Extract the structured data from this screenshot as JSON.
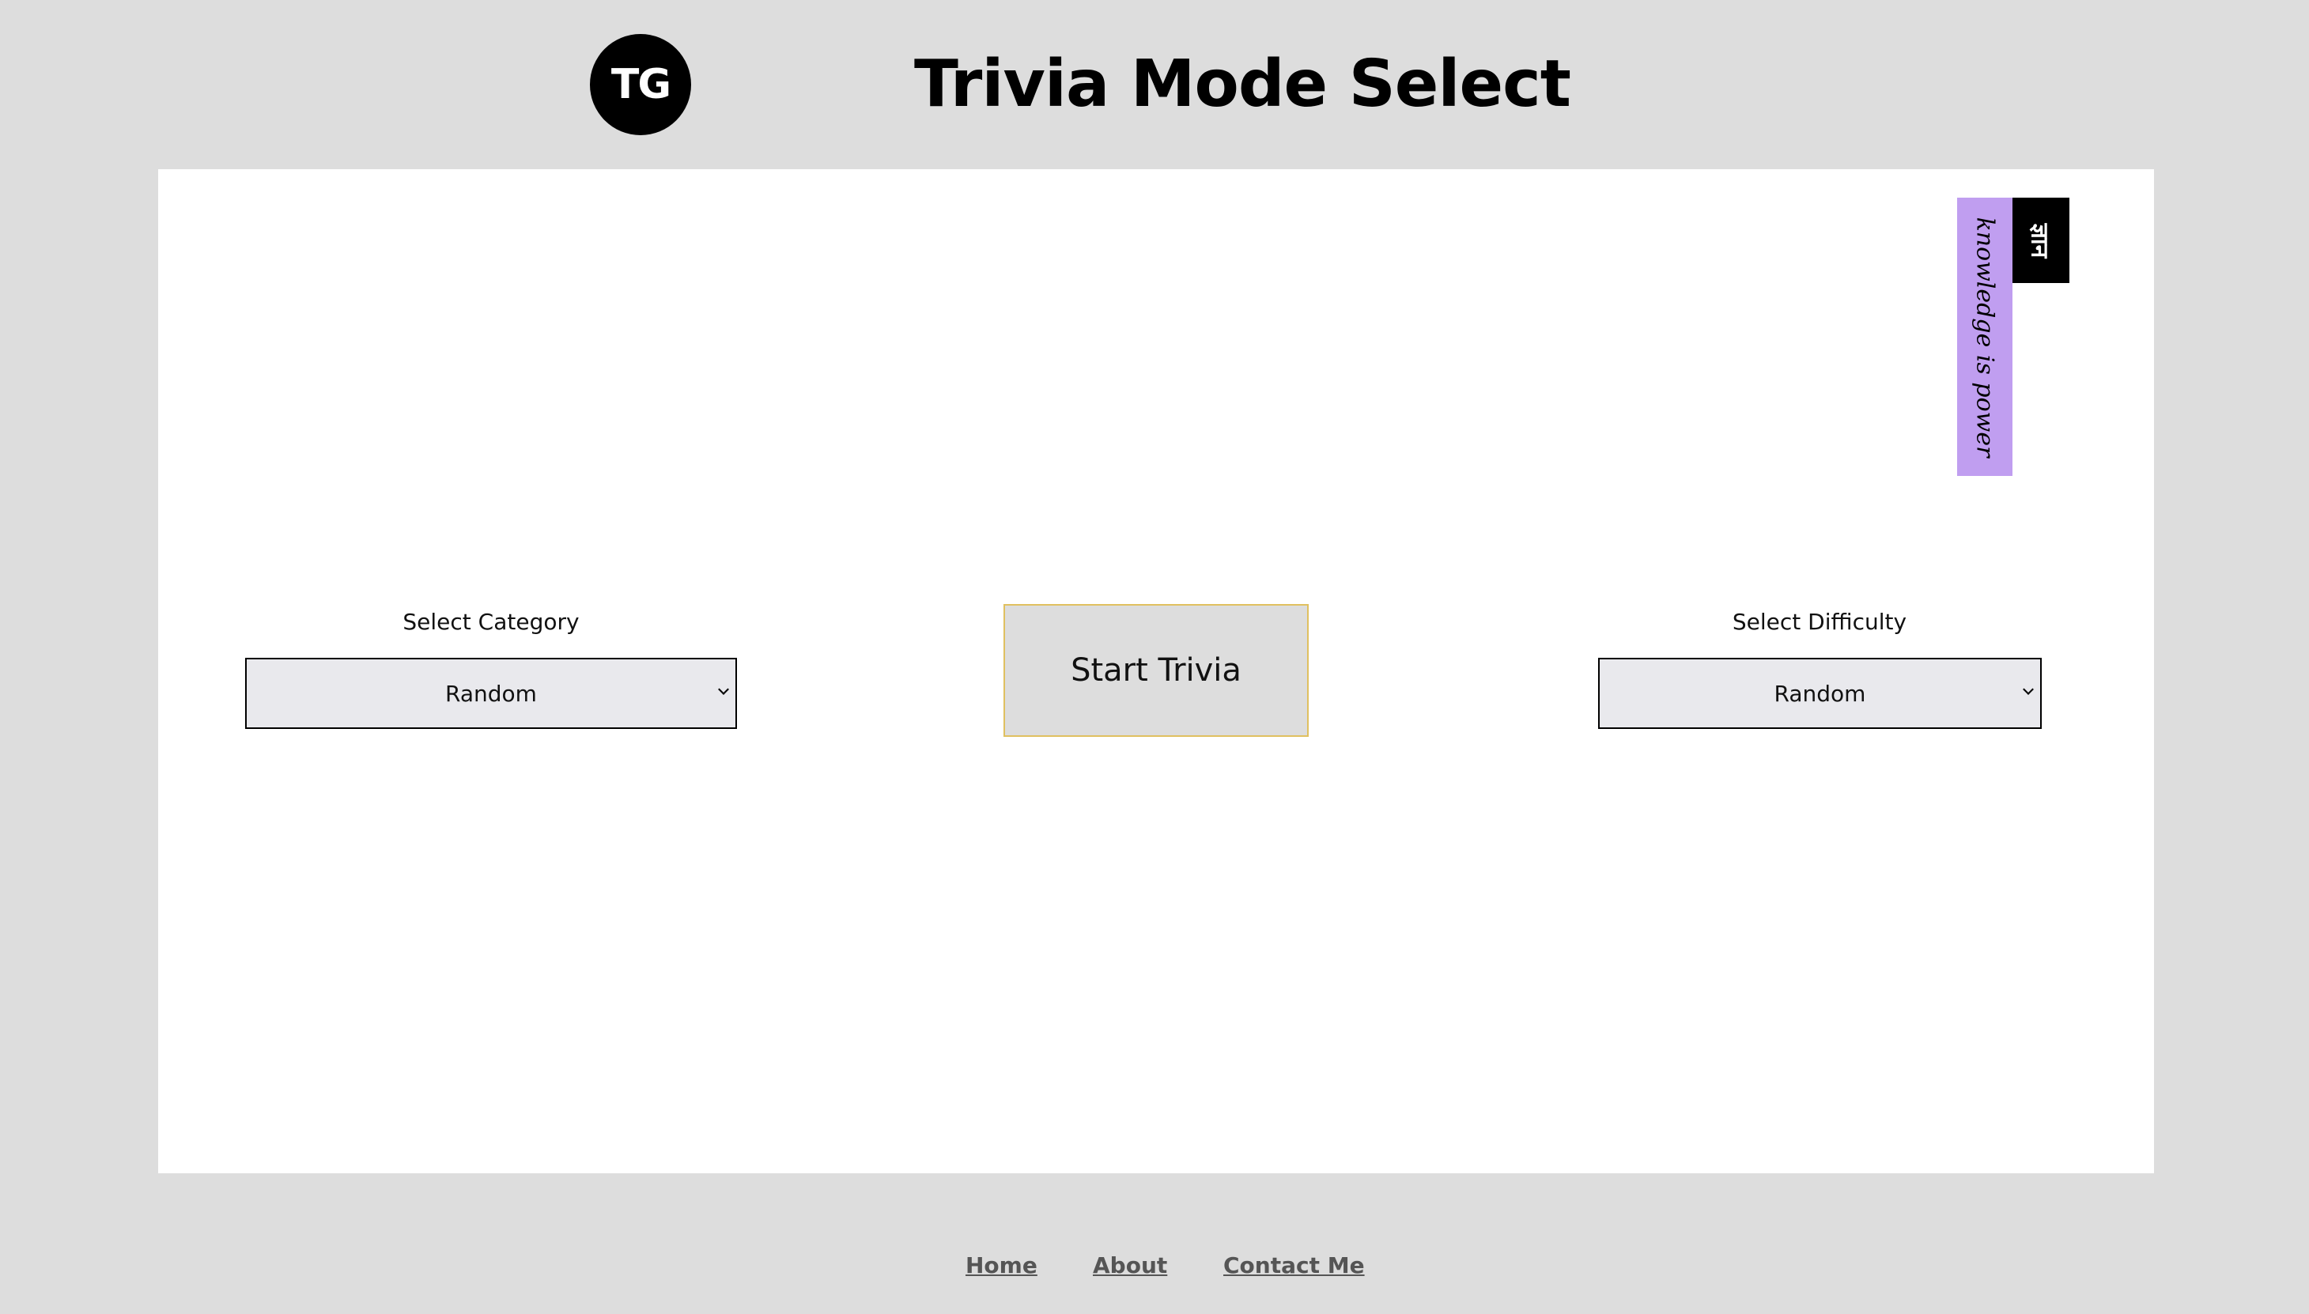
{
  "header": {
    "logo_text": "TG",
    "title": "Trivia Mode Select"
  },
  "ribbon": {
    "tagline": "knowledge is power",
    "tab_text": "ज्ञान"
  },
  "category": {
    "label": "Select Category",
    "selected": "Random"
  },
  "difficulty": {
    "label": "Select Difficulty",
    "selected": "Random"
  },
  "start_button": {
    "label": "Start Trivia"
  },
  "footer": {
    "links": [
      "Home",
      "About",
      "Contact Me"
    ]
  },
  "colors": {
    "page_background": "#dddddd",
    "panel_background": "#ffffff",
    "ribbon_purple": "#c09ef0",
    "button_border": "#e0c060",
    "select_background": "#e9e9ed"
  },
  "icons": {
    "select_chevron": "chevron-down-icon"
  }
}
